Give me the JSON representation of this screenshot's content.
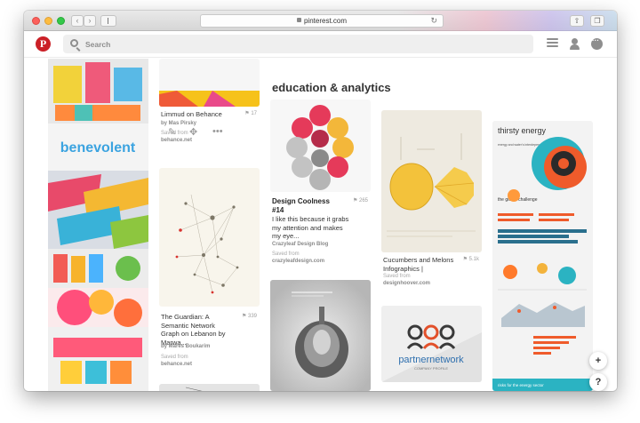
{
  "browser": {
    "url": "pinterest.com",
    "back_icon": "chevron-left-icon",
    "forward_icon": "chevron-right-icon"
  },
  "header": {
    "logo": "P",
    "search_placeholder": "Search"
  },
  "board": {
    "title": "education & analytics"
  },
  "colors": {
    "pinterest_red": "#cb2027",
    "traffic_red": "#fc605c",
    "traffic_yellow": "#fdbc40",
    "traffic_green": "#34c84a"
  },
  "pins": [
    {
      "id": "limmud",
      "title": "Limmud on Behance",
      "by": "by Mas Pirsky",
      "saved_from_label": "Saved from",
      "source": "behance.net",
      "count": "17"
    },
    {
      "id": "guardian",
      "title": "The Guardian: A Semantic Network Graph on Lebanon by Marwa...",
      "by": "by Mares Boukarim",
      "saved_from_label": "Saved from",
      "source": "behance.net",
      "count": "339"
    },
    {
      "id": "design-coolness",
      "title": "Design Coolness #14",
      "description": "I like this because it grabs my attention and makes my eye...",
      "by": "Crazyleaf Design Blog",
      "saved_from_label": "Saved from",
      "source": "crazyleafdesign.com",
      "count": "265"
    },
    {
      "id": "cucumbers",
      "title": "Cucumbers and Melons Infographics |",
      "saved_from_label": "Saved from",
      "source": "designhoover.com",
      "count": "5.1k"
    }
  ],
  "images": {
    "benevolent_text": "benevolent",
    "partner_text": "partnernetwork",
    "partner_sub": "COMPANY PROFILE",
    "thirsty_title": "thirsty energy",
    "thirsty_sub": "energy and water's interdependence",
    "global_challenge": "the global challenge",
    "bottom_caption": "risks for the energy sector"
  },
  "fabs": {
    "add": "+",
    "help": "?"
  }
}
